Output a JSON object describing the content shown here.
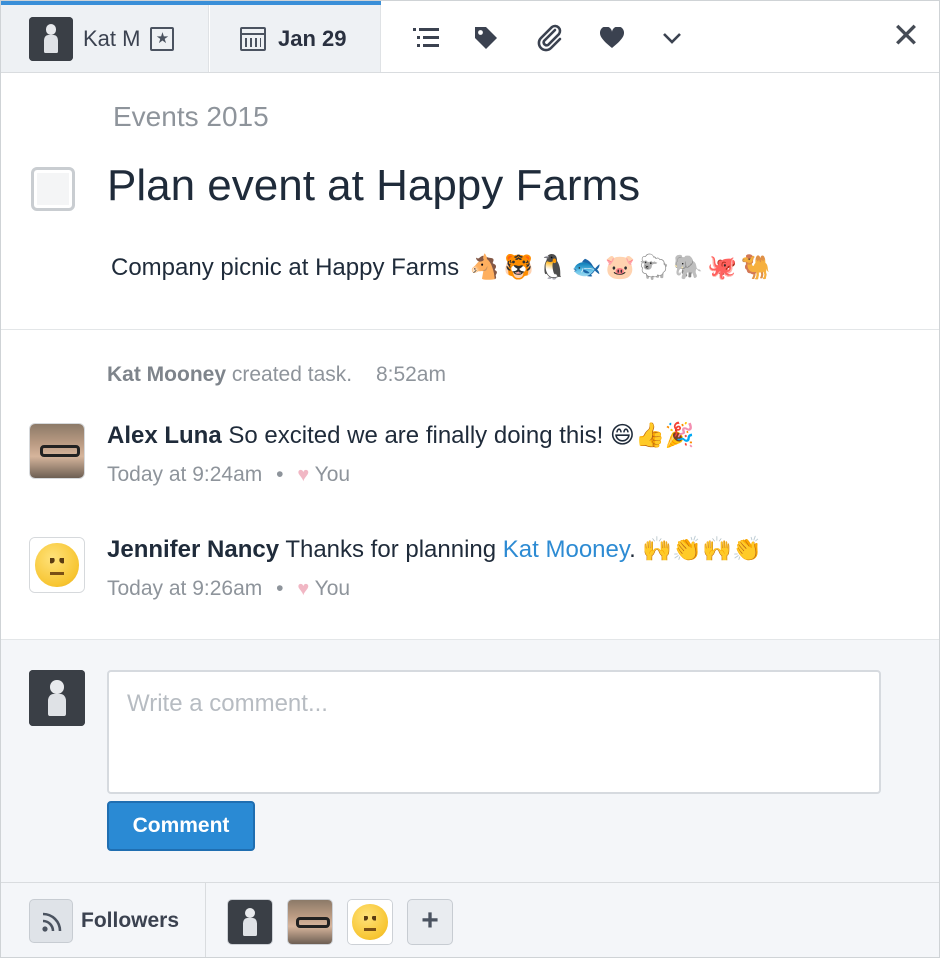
{
  "toolbar": {
    "assignee_name": "Kat M",
    "due_date": "Jan 29",
    "icons": [
      "subtasks-icon",
      "tag-icon",
      "attachment-icon",
      "heart-icon",
      "chevron-down-icon",
      "close-icon"
    ]
  },
  "task": {
    "project": "Events 2015",
    "title": "Plan event at Happy Farms",
    "description": "Company picnic at Happy Farms",
    "description_emoji": "🐴🐯🐧🐟🐷🐑🐘🐙🐫"
  },
  "stories": {
    "created_by": "Kat Mooney",
    "created_text": "created task.",
    "created_time": "8:52am",
    "comments": [
      {
        "author": "Alex Luna",
        "text": "So excited we are finally doing this!",
        "emoji": "😄👍🎉",
        "time": "Today at 9:24am",
        "bullet": "•",
        "heart": "♥",
        "liked_by": "You"
      },
      {
        "author": "Jennifer Nancy",
        "text_before": "Thanks for planning",
        "mention": "Kat Mooney",
        "text_after": ".",
        "emoji": "🙌👏🙌👏",
        "time": "Today at 9:26am",
        "bullet": "•",
        "heart": "♥",
        "liked_by": "You"
      }
    ]
  },
  "composer": {
    "placeholder": "Write a comment...",
    "button_label": "Comment"
  },
  "followers": {
    "label": "Followers",
    "add_label": "+"
  },
  "colors": {
    "accent": "#3a8fd8",
    "button": "#2a8ad4",
    "mention": "#2d8bd3",
    "heart": "#f1b7c4"
  }
}
